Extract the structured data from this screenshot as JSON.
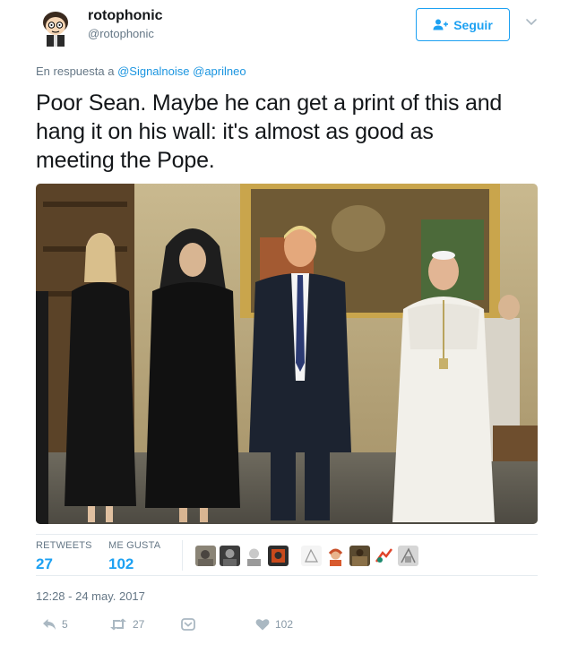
{
  "tweet": {
    "display_name": "rotophonic",
    "screen_name": "@rotophonic",
    "follow_label": "Seguir",
    "reply_prefix": "En respuesta a",
    "reply_mention_1": "@Signalnoise",
    "reply_mention_2": "@aprilneo",
    "text_line_1": "Poor Sean. Maybe he can get a print of this and",
    "text_line_2": "hang it on his wall: it's almost as good as",
    "text_line_3": "meeting the Pope.",
    "timestamp": "12:28 - 24 may. 2017"
  },
  "stats": {
    "retweets_label": "RETWEETS",
    "retweets_count": "27",
    "likes_label": "ME GUSTA",
    "likes_count": "102"
  },
  "actions": {
    "reply_count": "5",
    "retweet_count": "27",
    "like_count": "102"
  },
  "icons": {
    "follow": "add-user-icon",
    "caret": "chevron-down-icon",
    "reply": "reply-icon",
    "retweet": "retweet-icon",
    "dm": "direct-message-icon",
    "like": "heart-icon"
  },
  "colors": {
    "accent": "#1da1f2",
    "link": "#1b95e0",
    "muted": "#657786",
    "action": "#8899a6"
  }
}
